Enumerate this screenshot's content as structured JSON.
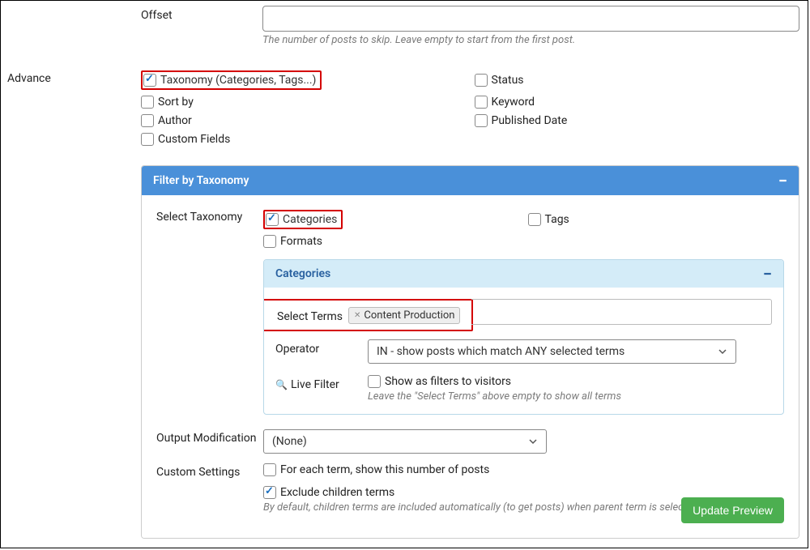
{
  "offset": {
    "label": "Offset",
    "value": "",
    "helper": "The number of posts to skip. Leave empty to start from the first post."
  },
  "advance": {
    "label": "Advance",
    "options": {
      "taxonomy": {
        "label": "Taxonomy (Categories, Tags...)",
        "checked": true
      },
      "status": {
        "label": "Status",
        "checked": false
      },
      "sortby": {
        "label": "Sort by",
        "checked": false
      },
      "keyword": {
        "label": "Keyword",
        "checked": false
      },
      "author": {
        "label": "Author",
        "checked": false
      },
      "published": {
        "label": "Published Date",
        "checked": false
      },
      "custom_fields": {
        "label": "Custom Fields",
        "checked": false
      }
    }
  },
  "taxonomy_panel": {
    "title": "Filter by Taxonomy",
    "select_taxonomy_label": "Select Taxonomy",
    "taxonomies": {
      "categories": {
        "label": "Categories",
        "checked": true
      },
      "tags": {
        "label": "Tags",
        "checked": false
      },
      "formats": {
        "label": "Formats",
        "checked": false
      }
    },
    "categories_panel": {
      "title": "Categories",
      "select_terms_label": "Select Terms",
      "terms": [
        "Content Production"
      ],
      "operator_label": "Operator",
      "operator_value": "IN - show posts which match ANY selected terms",
      "live_filter_label": "Live Filter",
      "show_filters": {
        "label": "Show as filters to visitors",
        "checked": false
      },
      "live_filter_helper": "Leave the \"Select Terms\" above empty to show all terms"
    },
    "output_modification_label": "Output Modification",
    "output_modification_value": "(None)",
    "custom_settings_label": "Custom Settings",
    "each_term": {
      "label": "For each term, show this number of posts",
      "checked": false
    },
    "exclude_children": {
      "label": "Exclude children terms",
      "checked": true
    },
    "exclude_helper": "By default, children terms are included automatically (to get posts) when parent term is selected.",
    "update_button": "Update Preview"
  }
}
